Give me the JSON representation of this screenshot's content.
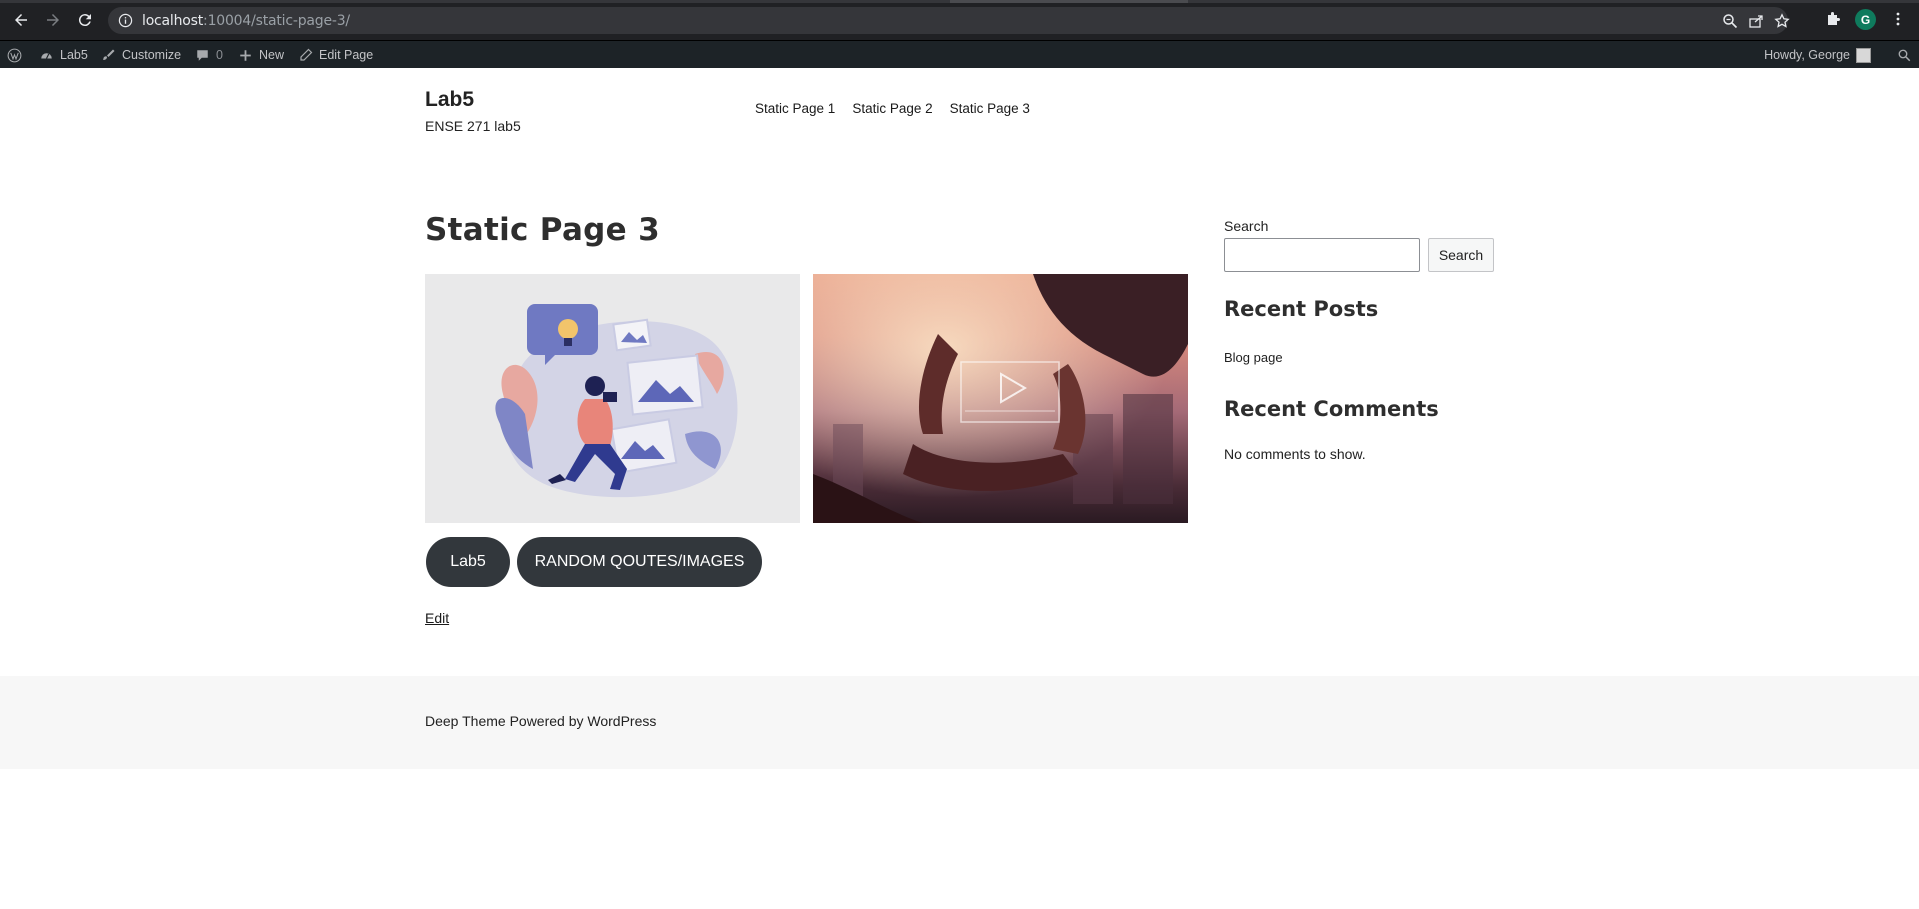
{
  "browser": {
    "url_host": "localhost",
    "url_rest": ":10004/static-page-3/",
    "profile_initial": "G",
    "profile_color": "#0f7b5d"
  },
  "adminbar": {
    "site": "Lab5",
    "customize": "Customize",
    "comments_count": "0",
    "new": "New",
    "edit_page": "Edit Page",
    "howdy": "Howdy, George"
  },
  "site": {
    "title": "Lab5",
    "description": "ENSE 271 lab5"
  },
  "menu": {
    "items": [
      "Static Page 1",
      "Static Page 2",
      "Static Page 3"
    ]
  },
  "main": {
    "page_title": "Static Page 3",
    "images": [
      "illustration-photographer-image",
      "hands-frame-video-image"
    ],
    "buttons": [
      "Lab5",
      "RANDOM QOUTES/IMAGES"
    ],
    "edit_link": "Edit"
  },
  "sidebar": {
    "search_label": "Search",
    "search_button": "Search",
    "search_value": "",
    "recent_posts_heading": "Recent Posts",
    "recent_posts": [
      "Blog page"
    ],
    "recent_comments_heading": "Recent Comments",
    "no_comments": "No comments to show."
  },
  "footer": {
    "text": "Deep Theme Powered by WordPress"
  },
  "colors": {
    "chrome_bg": "#202124",
    "adminbar_bg": "#1d2327",
    "button_bg": "#32373c",
    "footer_bg": "#f7f7f7"
  }
}
